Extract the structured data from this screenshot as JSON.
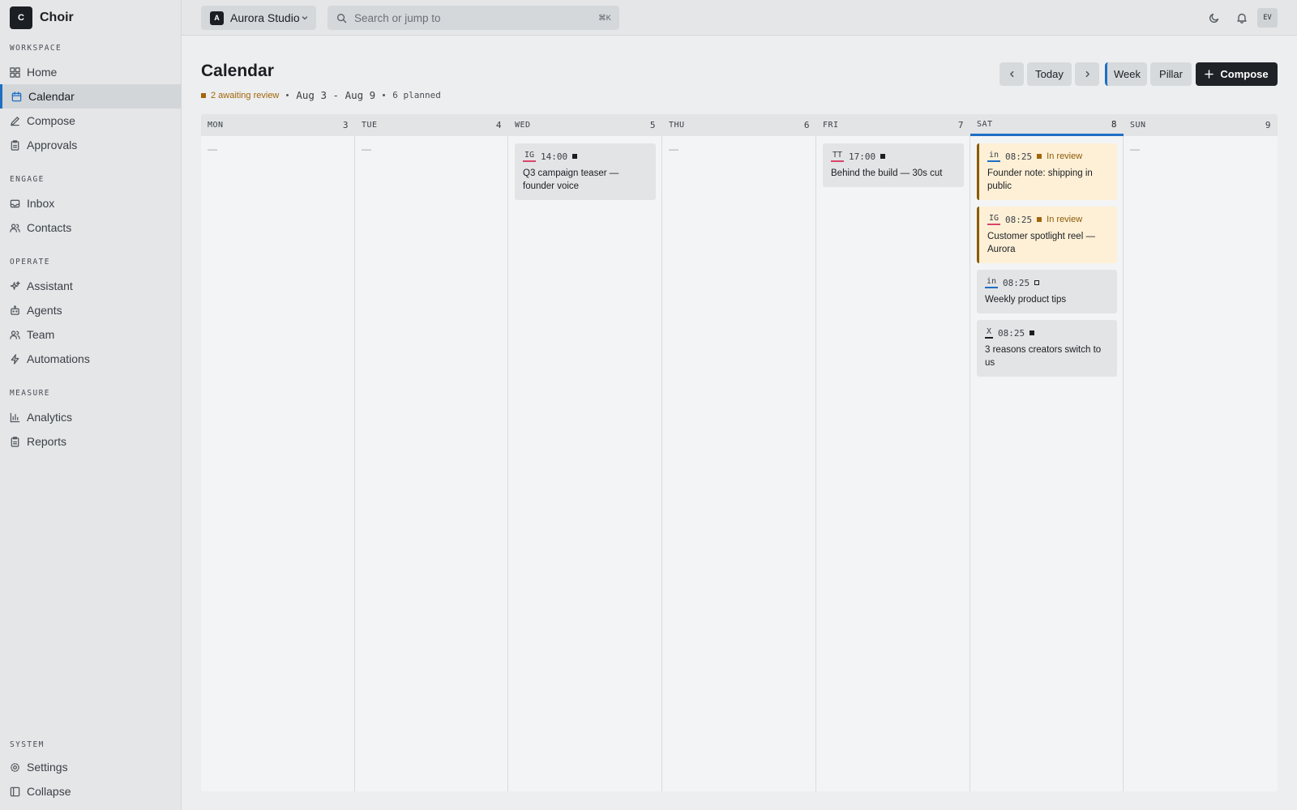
{
  "app": {
    "logo_letter": "C",
    "name": "Choir"
  },
  "sidebar": {
    "sections": [
      {
        "heading": "WORKSPACE",
        "items": [
          {
            "label": "Home",
            "icon": "grid-icon"
          },
          {
            "label": "Calendar",
            "icon": "calendar-icon",
            "active": true
          },
          {
            "label": "Compose",
            "icon": "pen-icon"
          },
          {
            "label": "Approvals",
            "icon": "clipboard-icon"
          }
        ]
      },
      {
        "heading": "ENGAGE",
        "items": [
          {
            "label": "Inbox",
            "icon": "inbox-icon"
          },
          {
            "label": "Contacts",
            "icon": "users-icon"
          }
        ]
      },
      {
        "heading": "OPERATE",
        "items": [
          {
            "label": "Assistant",
            "icon": "sparkle-icon"
          },
          {
            "label": "Agents",
            "icon": "bot-icon"
          },
          {
            "label": "Team",
            "icon": "team-icon"
          },
          {
            "label": "Automations",
            "icon": "bolt-icon"
          }
        ]
      },
      {
        "heading": "MEASURE",
        "items": [
          {
            "label": "Analytics",
            "icon": "bar-chart-icon"
          },
          {
            "label": "Reports",
            "icon": "report-icon"
          }
        ]
      },
      {
        "heading": "SYSTEM",
        "items": [
          {
            "label": "Settings",
            "icon": "gear-icon"
          },
          {
            "label": "Collapse",
            "icon": "collapse-icon"
          }
        ]
      }
    ]
  },
  "topbar": {
    "workspace_avatar": "A",
    "workspace_name": "Aurora Studio",
    "search_placeholder": "Search or jump to",
    "search_shortcut": "⌘K",
    "user_initials": "EV"
  },
  "header": {
    "title": "Calendar",
    "awaiting_review": "2 awaiting review",
    "date_range": "Aug 3 - Aug 9",
    "planned": "6 planned",
    "today_label": "Today",
    "week_label": "Week",
    "pillar_label": "Pillar",
    "compose_label": "Compose"
  },
  "calendar": {
    "days": [
      {
        "name": "MON",
        "num": "3",
        "empty": "—",
        "posts": []
      },
      {
        "name": "TUE",
        "num": "4",
        "empty": "—",
        "posts": []
      },
      {
        "name": "WED",
        "num": "5",
        "posts": [
          {
            "platform": "IG",
            "time": "14:00",
            "status": "scheduled",
            "title": "Q3 campaign teaser — founder voice"
          }
        ]
      },
      {
        "name": "THU",
        "num": "6",
        "empty": "—",
        "posts": []
      },
      {
        "name": "FRI",
        "num": "7",
        "posts": [
          {
            "platform": "TT",
            "time": "17:00",
            "status": "scheduled",
            "title": "Behind the build — 30s cut"
          }
        ]
      },
      {
        "name": "SAT",
        "num": "8",
        "today": true,
        "posts": [
          {
            "platform": "in",
            "time": "08:25",
            "status": "review",
            "status_label": "In review",
            "title": "Founder note: shipping in public"
          },
          {
            "platform": "IG",
            "time": "08:25",
            "status": "review",
            "status_label": "In review",
            "title": "Customer spotlight reel — Aurora"
          },
          {
            "platform": "in",
            "time": "08:25",
            "status": "draft",
            "title": "Weekly product tips"
          },
          {
            "platform": "X",
            "time": "08:25",
            "status": "scheduled",
            "title": "3 reasons creators switch to us"
          }
        ]
      },
      {
        "name": "SUN",
        "num": "9",
        "empty": "—",
        "posts": []
      }
    ]
  },
  "colors": {
    "accent": "#1f6fc4",
    "review": "#a2650a",
    "review_bg": "#fdf0d6",
    "primary_button": "#1f2328"
  }
}
